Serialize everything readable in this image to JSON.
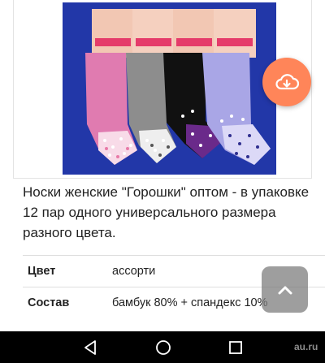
{
  "product": {
    "description": "Носки женские \"Горошки\" оптом - в упаковке 12 пар одного универсального размера разного цвета."
  },
  "specs": [
    {
      "name": "Цвет",
      "value": "ассорти"
    },
    {
      "name": "Состав",
      "value": "бамбук 80% + спандекс 10%"
    }
  ],
  "fab": {
    "icon": "cloud-download-icon",
    "color": "#ff8559"
  },
  "scroll_top": {
    "icon": "chevron-up-icon"
  },
  "navbar": {
    "back_icon": "back-triangle-icon",
    "home_icon": "home-circle-icon",
    "recents_icon": "recents-square-icon"
  },
  "watermark": "au.ru",
  "colors": {
    "photo_background": "#2237a8",
    "fab": "#ff8559",
    "navbar": "#000000"
  }
}
